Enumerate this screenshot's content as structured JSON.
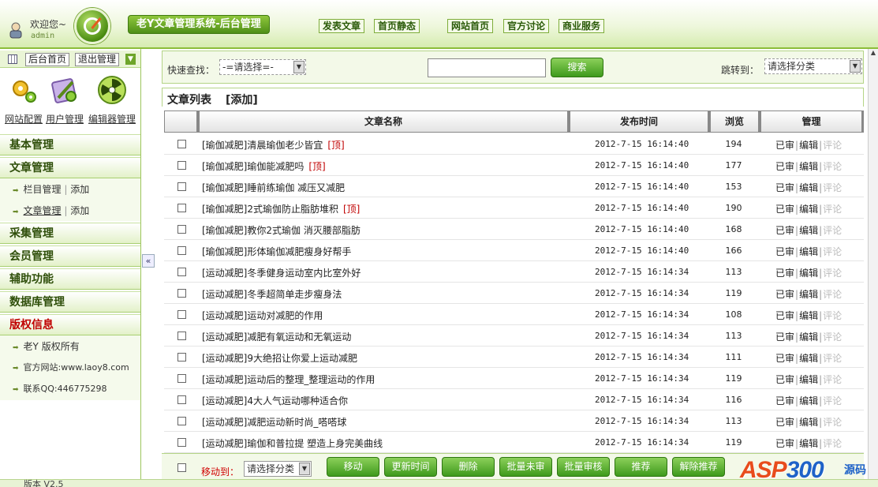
{
  "header": {
    "welcome": "欢迎您~",
    "username": "admin",
    "system_title": "老Y文章管理系统-后台管理",
    "nav": [
      "发表文章",
      "首页静态",
      "网站首页",
      "官方讨论",
      "商业服务"
    ]
  },
  "sidebar": {
    "toolbar": {
      "home": "后台首页",
      "logout": "退出管理"
    },
    "quick_links": [
      "网站配置",
      "用户管理",
      "编辑器管理"
    ],
    "sections": [
      {
        "title": "基本管理"
      },
      {
        "title": "文章管理",
        "items": [
          {
            "label": "栏目管理",
            "extra": "添加"
          },
          {
            "label": "文章管理",
            "extra": "添加"
          }
        ]
      },
      {
        "title": "采集管理"
      },
      {
        "title": "会员管理"
      },
      {
        "title": "辅助功能"
      },
      {
        "title": "数据库管理"
      },
      {
        "title": "版权信息",
        "items": [
          {
            "label": "老Y 版权所有"
          },
          {
            "label": "官方网站:www.laoy8.com"
          },
          {
            "label": "联系QQ:446775298"
          }
        ]
      }
    ],
    "version": "版本 V2.5"
  },
  "search": {
    "label": "快速查找：",
    "select_value": "-=请选择=-",
    "keyword_value": "",
    "button": "搜索",
    "jump_label": "跳转到：",
    "jump_value": "请选择分类"
  },
  "list": {
    "title": "文章列表",
    "add_link": "[添加]",
    "columns": [
      "文章名称",
      "发布时间",
      "浏览",
      "管理"
    ],
    "rows": [
      {
        "name": "[瑜伽减肥]清晨瑜伽老少皆宜",
        "top": "[顶]",
        "date": "2012-7-15 16:14:40",
        "views": "194"
      },
      {
        "name": "[瑜伽减肥]瑜伽能减肥吗",
        "top": "[顶]",
        "date": "2012-7-15 16:14:40",
        "views": "177"
      },
      {
        "name": "[瑜伽减肥]睡前练瑜伽 减压又减肥",
        "top": "",
        "date": "2012-7-15 16:14:40",
        "views": "153"
      },
      {
        "name": "[瑜伽减肥]2式瑜伽防止脂肪堆积",
        "top": "[顶]",
        "date": "2012-7-15 16:14:40",
        "views": "190"
      },
      {
        "name": "[瑜伽减肥]教你2式瑜伽 消灭腰部脂肪",
        "top": "",
        "date": "2012-7-15 16:14:40",
        "views": "168"
      },
      {
        "name": "[瑜伽减肥]形体瑜伽减肥瘦身好帮手",
        "top": "",
        "date": "2012-7-15 16:14:40",
        "views": "166"
      },
      {
        "name": "[运动减肥]冬季健身运动室内比室外好",
        "top": "",
        "date": "2012-7-15 16:14:34",
        "views": "113"
      },
      {
        "name": "[运动减肥]冬季超简单走步瘦身法",
        "top": "",
        "date": "2012-7-15 16:14:34",
        "views": "119"
      },
      {
        "name": "[运动减肥]运动对减肥的作用",
        "top": "",
        "date": "2012-7-15 16:14:34",
        "views": "108"
      },
      {
        "name": "[运动减肥]减肥有氧运动和无氧运动",
        "top": "",
        "date": "2012-7-15 16:14:34",
        "views": "113"
      },
      {
        "name": "[运动减肥]9大绝招让你爱上运动减肥",
        "top": "",
        "date": "2012-7-15 16:14:34",
        "views": "111"
      },
      {
        "name": "[运动减肥]运动后的整理_整理运动的作用",
        "top": "",
        "date": "2012-7-15 16:14:34",
        "views": "119"
      },
      {
        "name": "[运动减肥]4大人气运动哪种适合你",
        "top": "",
        "date": "2012-7-15 16:14:34",
        "views": "116"
      },
      {
        "name": "[运动减肥]减肥运动新时尚_嗒嗒球",
        "top": "",
        "date": "2012-7-15 16:14:34",
        "views": "113"
      },
      {
        "name": "[运动减肥]瑜伽和普拉提 塑造上身完美曲线",
        "top": "",
        "date": "2012-7-15 16:14:34",
        "views": "119"
      }
    ],
    "ops": {
      "approved": "已审",
      "edit": "编辑",
      "comment": "评论",
      "sep": "|"
    }
  },
  "bottom": {
    "move_label": "移动到：",
    "move_value": "请选择分类",
    "buttons": [
      "移动",
      "更新时间",
      "删除",
      "批量未审",
      "批量审核",
      "推荐",
      "解除推荐"
    ]
  },
  "watermark": {
    "brand_a": "ASP",
    "brand_b": "300",
    "sub": "源码"
  }
}
